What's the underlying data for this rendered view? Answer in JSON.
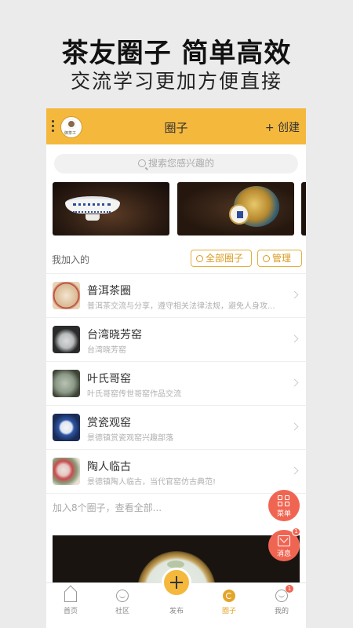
{
  "promo": {
    "title": "茶友圈子 简单高效",
    "subtitle": "交流学习更加方便直接"
  },
  "header": {
    "logo_text": "御茶工",
    "title": "圈子",
    "create_label": "+ 创建"
  },
  "search": {
    "placeholder": "搜索您感兴趣的"
  },
  "joined": {
    "label": "我加入的",
    "all_circles_label": "全部圈子",
    "manage_label": "管理",
    "items": [
      {
        "title": "普洱茶圈",
        "desc": "普洱茶交流与分享，遵守相关法律法规，避免人身攻..."
      },
      {
        "title": "台湾晓芳窑",
        "desc": "台湾晓芳窑"
      },
      {
        "title": "叶氏哥窑",
        "desc": "叶氏哥窑传世哥窑作品交流"
      },
      {
        "title": "赏瓷观窑",
        "desc": "景德镇赏瓷观窑兴趣部落"
      },
      {
        "title": "陶人临古",
        "desc": "景德镇陶人临古，当代官窑仿古典范!"
      }
    ],
    "footer_note": "加入8个圈子，查看全部..."
  },
  "float_buttons": {
    "menu_label": "菜单",
    "message_label": "消息",
    "message_badge": "1"
  },
  "tabbar": {
    "tabs": [
      {
        "label": "首页",
        "icon": "home-icon"
      },
      {
        "label": "社区",
        "icon": "chat-icon"
      },
      {
        "label": "发布",
        "icon": "plus-icon"
      },
      {
        "label": "圈子",
        "icon": "circle-icon",
        "active": true
      },
      {
        "label": "我的",
        "icon": "user-icon",
        "badge": "1"
      }
    ]
  },
  "colors": {
    "accent": "#f4b83d",
    "accent_text": "#e3a42b",
    "float_red": "#f06552"
  }
}
